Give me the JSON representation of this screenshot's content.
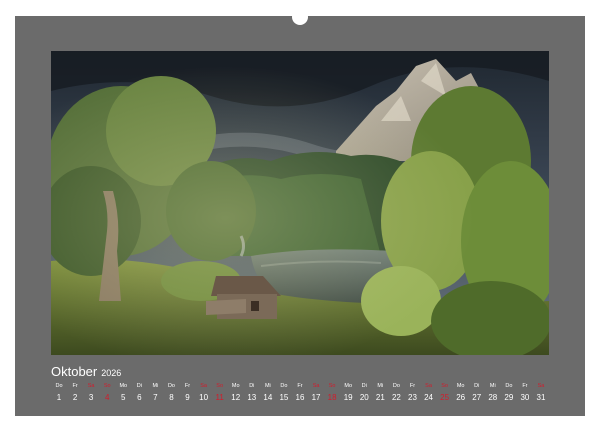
{
  "calendar": {
    "month": "Oktober",
    "year": "2026",
    "days": [
      {
        "wd": "Do",
        "d": "1",
        "kind": "wk"
      },
      {
        "wd": "Fr",
        "d": "2",
        "kind": "wk"
      },
      {
        "wd": "Sa",
        "d": "3",
        "kind": "sun"
      },
      {
        "wd": "So",
        "d": "4",
        "kind": "sun"
      },
      {
        "wd": "Mo",
        "d": "5",
        "kind": "wk"
      },
      {
        "wd": "Di",
        "d": "6",
        "kind": "wk"
      },
      {
        "wd": "Mi",
        "d": "7",
        "kind": "wk"
      },
      {
        "wd": "Do",
        "d": "8",
        "kind": "wk"
      },
      {
        "wd": "Fr",
        "d": "9",
        "kind": "wk"
      },
      {
        "wd": "Sa",
        "d": "10",
        "kind": "sun"
      },
      {
        "wd": "So",
        "d": "11",
        "kind": "sun"
      },
      {
        "wd": "Mo",
        "d": "12",
        "kind": "wk"
      },
      {
        "wd": "Di",
        "d": "13",
        "kind": "wk"
      },
      {
        "wd": "Mi",
        "d": "14",
        "kind": "wk"
      },
      {
        "wd": "Do",
        "d": "15",
        "kind": "wk"
      },
      {
        "wd": "Fr",
        "d": "16",
        "kind": "wk"
      },
      {
        "wd": "Sa",
        "d": "17",
        "kind": "sun"
      },
      {
        "wd": "So",
        "d": "18",
        "kind": "sun"
      },
      {
        "wd": "Mo",
        "d": "19",
        "kind": "wk"
      },
      {
        "wd": "Di",
        "d": "20",
        "kind": "wk"
      },
      {
        "wd": "Mi",
        "d": "21",
        "kind": "wk"
      },
      {
        "wd": "Do",
        "d": "22",
        "kind": "wk"
      },
      {
        "wd": "Fr",
        "d": "23",
        "kind": "wk"
      },
      {
        "wd": "Sa",
        "d": "24",
        "kind": "sun"
      },
      {
        "wd": "So",
        "d": "25",
        "kind": "sun"
      },
      {
        "wd": "Mo",
        "d": "26",
        "kind": "wk"
      },
      {
        "wd": "Di",
        "d": "27",
        "kind": "wk"
      },
      {
        "wd": "Mi",
        "d": "28",
        "kind": "wk"
      },
      {
        "wd": "Do",
        "d": "29",
        "kind": "wk"
      },
      {
        "wd": "Fr",
        "d": "30",
        "kind": "wk"
      },
      {
        "wd": "Sa",
        "d": "31",
        "kind": "sun"
      }
    ]
  },
  "colors": {
    "page": "#6b6b6b",
    "text": "#ffffff",
    "weekend": "#d21c2c",
    "binding": "#ffffff"
  },
  "photo": {
    "subject": "forest lake with wooden cabin and mountain peak",
    "icons": [
      "binding-wire",
      "cabin-icon"
    ]
  }
}
